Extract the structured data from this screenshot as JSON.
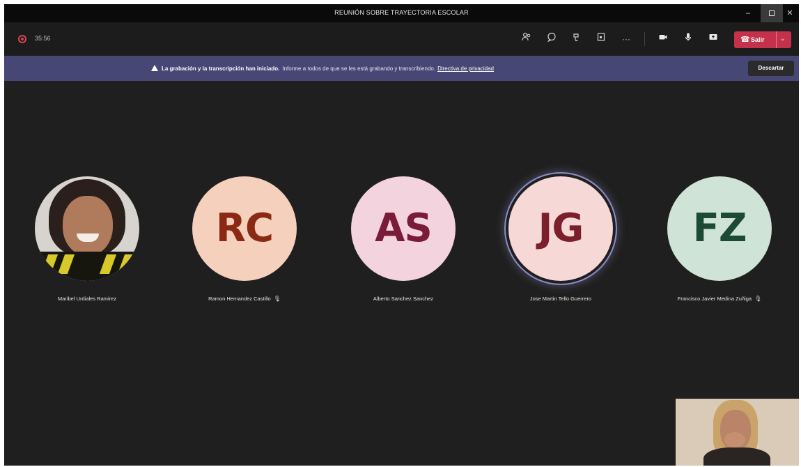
{
  "window": {
    "title": "REUNIÓN SOBRE TRAYECTORIA ESCOLAR",
    "minimize_icon": "–",
    "close_icon": "✕"
  },
  "toolbar": {
    "timer": "35:56",
    "icons": [
      "people-icon",
      "chat-icon",
      "reactions-icon",
      "rooms-icon",
      "more-icon",
      "camera-icon",
      "mic-icon",
      "share-icon"
    ],
    "more_label": "···",
    "leave_label": "Salir",
    "leave_color": "#c4314b"
  },
  "banner": {
    "bold_text": "La grabación y la transcripción han iniciado.",
    "text": "Informe a todos de que se les está grabando y transcribiendo.",
    "link": "Directiva de privacidad",
    "dismiss_label": "Descartar",
    "background": "#464775"
  },
  "participants": [
    {
      "name": "Maribel Urdiales Ramirez",
      "initials": "",
      "photo": true,
      "muted": false,
      "speaking": false
    },
    {
      "name": "Ramon Hernandez Castillo",
      "initials": "RC",
      "bg": "#f4d0bd",
      "fg": "#8a2a12",
      "muted": true,
      "speaking": false
    },
    {
      "name": "Alberto Sanchez Sanchez",
      "initials": "AS",
      "bg": "#f3d3dd",
      "fg": "#7a1b3a",
      "muted": false,
      "speaking": false
    },
    {
      "name": "Jose Martin Tello Guerrero",
      "initials": "JG",
      "bg": "#f6d8d6",
      "fg": "#7a1f2b",
      "muted": false,
      "speaking": true
    },
    {
      "name": "Francisco Javier Medina Zuñiga",
      "initials": "FZ",
      "bg": "#cfe3d6",
      "fg": "#1d4a35",
      "muted": true,
      "speaking": false
    }
  ]
}
